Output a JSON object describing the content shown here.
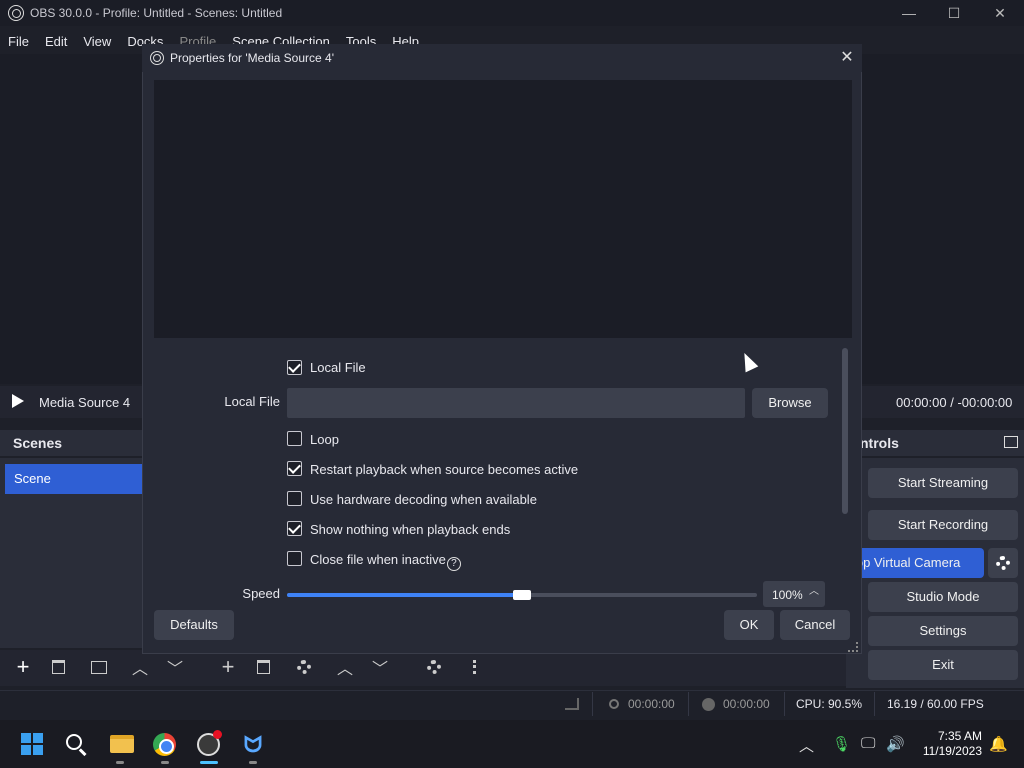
{
  "window": {
    "title": "OBS 30.0.0 - Profile: Untitled - Scenes: Untitled",
    "minimize": "—",
    "maximize": "☐",
    "close": "✕"
  },
  "menu": {
    "file": "File",
    "edit": "Edit",
    "view": "View",
    "docks": "Docks",
    "profile": "Profile",
    "scene_collection": "Scene Collection",
    "tools": "Tools",
    "help": "Help"
  },
  "media_controls": {
    "source_name": "Media Source 4",
    "time": "00:00:00  /  -00:00:00"
  },
  "scenes": {
    "header": "Scenes",
    "items": [
      "Scene"
    ]
  },
  "controls": {
    "header": "ntrols",
    "start_streaming": "Start Streaming",
    "start_recording": "Start Recording",
    "virtual_camera": "Stop Virtual Camera",
    "studio_mode": "Studio Mode",
    "settings": "Settings",
    "exit": "Exit"
  },
  "statusbar": {
    "stream_time": "00:00:00",
    "record_time": "00:00:00",
    "cpu": "CPU: 90.5%",
    "fps": "16.19 / 60.00 FPS"
  },
  "dialog": {
    "title": "Properties for 'Media Source 4'",
    "close": "✕",
    "local_file_checkbox": {
      "label": "Local File",
      "checked": true
    },
    "local_file_label": "Local File",
    "local_file_value": "",
    "browse": "Browse",
    "loop": {
      "label": "Loop",
      "checked": false
    },
    "restart": {
      "label": "Restart playback when source becomes active",
      "checked": true
    },
    "hw_decoding": {
      "label": "Use hardware decoding when available",
      "checked": false
    },
    "show_nothing": {
      "label": "Show nothing when playback ends",
      "checked": true
    },
    "close_inactive": {
      "label": "Close file when inactive",
      "checked": false
    },
    "speed_label": "Speed",
    "speed_value": "100%",
    "speed_fraction": 0.5,
    "defaults": "Defaults",
    "ok": "OK",
    "cancel": "Cancel"
  },
  "taskbar": {
    "time": "7:35 AM",
    "date": "11/19/2023"
  },
  "colors": {
    "accent": "#2f5fd4",
    "slider": "#3e82f7",
    "background": "#1e2029"
  }
}
